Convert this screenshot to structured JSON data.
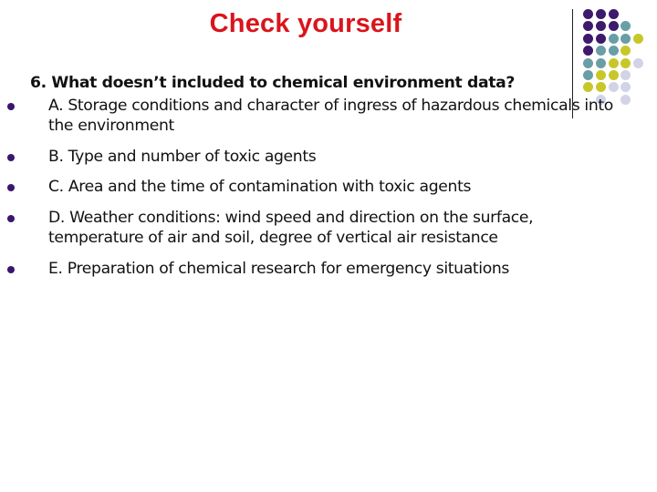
{
  "slide": {
    "title": "Check yourself",
    "question": "6. What doesn’t included to chemical environment data?",
    "options": [
      {
        "text": "A. Storage conditions and character of ingress of hazardous chemicals into the environment"
      },
      {
        "text": "B. Type and number of toxic agents"
      },
      {
        "text": "C. Area and the time of contamination with toxic agents"
      },
      {
        "text": "D. Weather conditions: wind speed and direction on the surface, temperature of air and soil, degree of vertical air resistance"
      },
      {
        "text": "E. Preparation of chemical research for emergency situations"
      }
    ],
    "bullet_icon": "filled-circle",
    "colors": {
      "title": "#d9151b",
      "bullet": "#3a1670",
      "purple": "#3d1a6b",
      "teal": "#6a9ea6",
      "yellow": "#c8c72a",
      "lavender": "#d2d3e6"
    },
    "decoration": {
      "grid": [
        "PPP",
        "PPPT",
        "PPTTY",
        "PTTY",
        "TTYYL",
        "TYYL",
        "YYLL",
        " L L"
      ]
    }
  }
}
